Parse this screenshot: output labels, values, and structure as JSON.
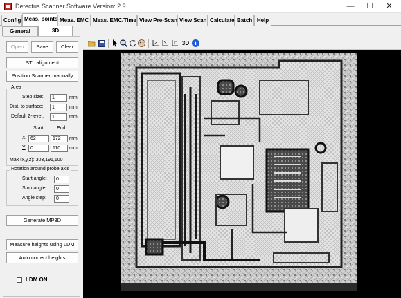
{
  "window": {
    "title": "Detectus Scanner Software Version: 2.9",
    "controls": [
      "—",
      "☐",
      "✕"
    ]
  },
  "menu_tabs": [
    "Config",
    "Meas. points",
    "Meas. EMC",
    "Meas. EMC/Time",
    "View Pre-Scan",
    "View Scan",
    "Calculate",
    "Batch",
    "Help"
  ],
  "active_menu_tab": "Meas. points",
  "sub_tabs": [
    "General",
    "3D"
  ],
  "active_sub_tab": "3D",
  "buttons": {
    "open": "Open",
    "save": "Save",
    "clear": "Clear",
    "stl_alignment": "STL alignment",
    "position_manually": "Position Scanner manually",
    "generate_mp3d": "Generate MP3D",
    "measure_heights": "Measure heights using LDM",
    "auto_correct": "Auto correct heights"
  },
  "area": {
    "title": "Area",
    "step_size_label": "Step size:",
    "step_size": "1",
    "dist_label": "Dist. to surface:",
    "dist": "1",
    "default_z_label": "Default Z-level:",
    "default_z": "1",
    "unit": "mm",
    "start_label": "Start:",
    "end_label": "End:",
    "x_label": "X",
    "x_start": "62",
    "x_end": "172",
    "y_label": "Y",
    "y_start": "0",
    "y_end": "110",
    "max_text": "Max (x,y,z): 303,191,100"
  },
  "rotation": {
    "title": "Rotation around probe axis",
    "start_label": "Start angle:",
    "start": "0",
    "stop_label": "Stop angle:",
    "stop": "0",
    "step_label": "Angle step:",
    "step": "0"
  },
  "ldm": {
    "label": "LDM ON",
    "checked": false
  },
  "toolbar": {
    "three_d_label": "3D",
    "info_label": "i"
  }
}
